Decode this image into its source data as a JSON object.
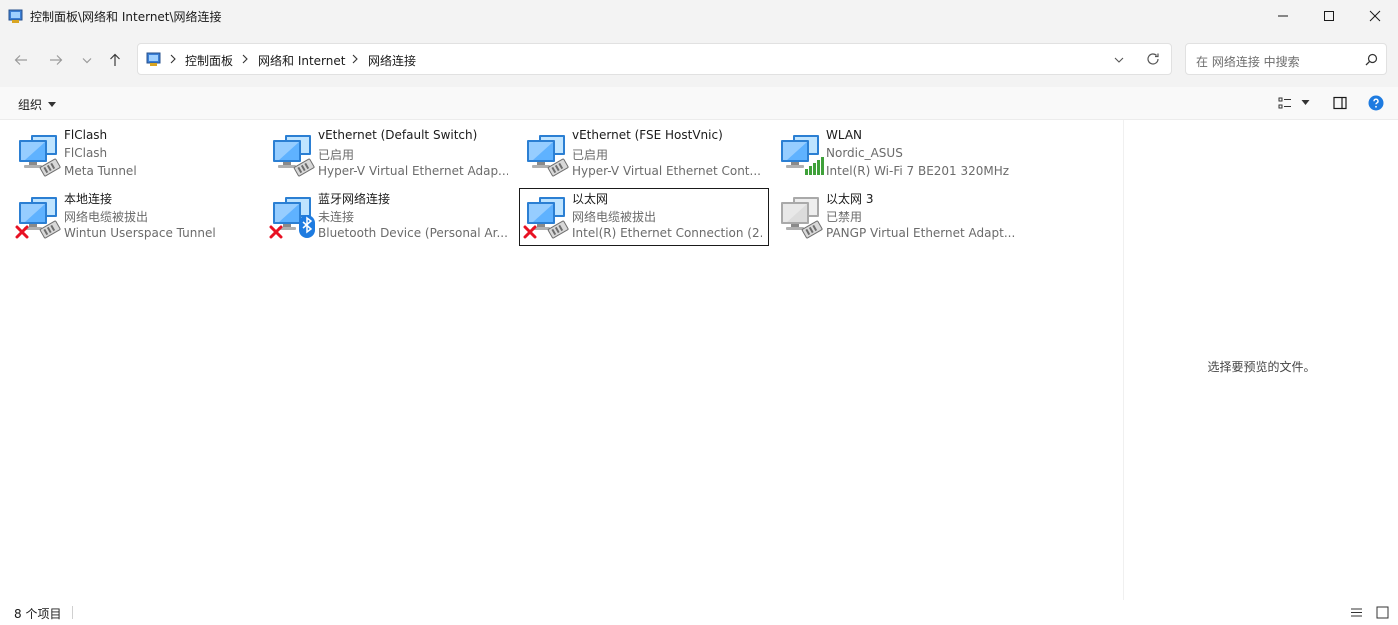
{
  "window": {
    "title": "控制面板\\网络和 Internet\\网络连接"
  },
  "address": {
    "crumbs": [
      "控制面板",
      "网络和 Internet",
      "网络连接"
    ]
  },
  "search": {
    "placeholder": "在 网络连接 中搜索"
  },
  "command_bar": {
    "organize_label": "组织"
  },
  "connections": [
    {
      "name": "FlClash",
      "status": "FlClash",
      "device": "Meta Tunnel",
      "badge": "none",
      "selected": false
    },
    {
      "name": "vEthernet (Default Switch)",
      "status": "已启用",
      "device": "Hyper-V Virtual Ethernet Adap...",
      "badge": "none",
      "selected": false
    },
    {
      "name": "vEthernet (FSE HostVnic)",
      "status": "已启用",
      "device": "Hyper-V Virtual Ethernet Cont...",
      "badge": "none",
      "selected": false
    },
    {
      "name": "WLAN",
      "status": "Nordic_ASUS",
      "device": "Intel(R) Wi-Fi 7 BE201 320MHz",
      "badge": "wifi-signal",
      "selected": false
    },
    {
      "name": "本地连接",
      "status": "网络电缆被拔出",
      "device": "Wintun Userspace Tunnel",
      "badge": "error-x",
      "selected": false
    },
    {
      "name": "蓝牙网络连接",
      "status": "未连接",
      "device": "Bluetooth Device (Personal Ar...",
      "badge": "error-x-bluetooth",
      "selected": false
    },
    {
      "name": "以太网",
      "status": "网络电缆被拔出",
      "device": "Intel(R) Ethernet Connection (2...",
      "badge": "error-x",
      "selected": true
    },
    {
      "name": "以太网 3",
      "status": "已禁用",
      "device": "PANGP Virtual Ethernet Adapt...",
      "badge": "disabled",
      "selected": false
    }
  ],
  "preview": {
    "message": "选择要预览的文件。"
  },
  "status_bar": {
    "item_count": "8 个项目"
  },
  "colors": {
    "accent": "#0067c0",
    "error": "#e81123",
    "wifi": "#3fa13a",
    "monitor": "#2b7fd3"
  }
}
